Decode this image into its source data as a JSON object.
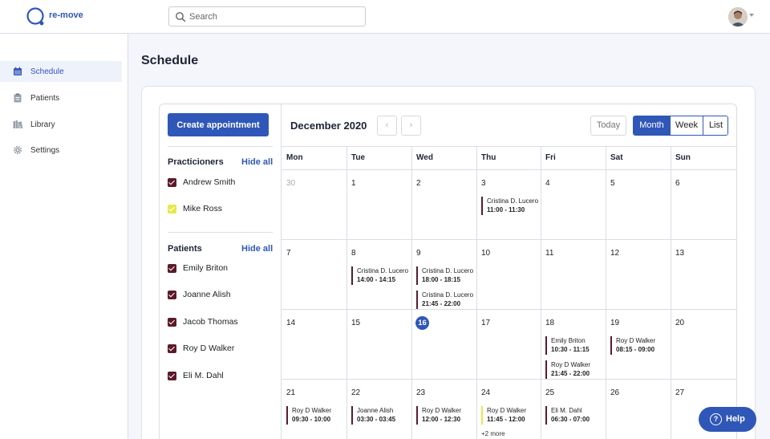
{
  "app": {
    "name": "re-move"
  },
  "search": {
    "placeholder": "Search"
  },
  "sidebar": {
    "items": [
      {
        "label": "Schedule",
        "icon": "calendar-icon",
        "active": true
      },
      {
        "label": "Patients",
        "icon": "clipboard-icon"
      },
      {
        "label": "Library",
        "icon": "library-icon"
      },
      {
        "label": "Settings",
        "icon": "gear-icon"
      }
    ]
  },
  "page": {
    "title": "Schedule"
  },
  "panel": {
    "create_label": "Create appointment",
    "practitioners": {
      "title": "Practicioners",
      "hide_label": "Hide all",
      "items": [
        {
          "name": "Andrew Smith",
          "color": "#5b1b2a"
        },
        {
          "name": "Mike Ross",
          "color": "#e7e84a"
        }
      ]
    },
    "patients": {
      "title": "Patients",
      "hide_label": "Hide all",
      "items": [
        {
          "name": "Emily Briton",
          "color": "#5b1b2a"
        },
        {
          "name": "Joanne Alish",
          "color": "#5b1b2a"
        },
        {
          "name": "Jacob Thomas",
          "color": "#5b1b2a"
        },
        {
          "name": "Roy D Walker",
          "color": "#5b1b2a"
        },
        {
          "name": "Eli M. Dahl",
          "color": "#5b1b2a"
        }
      ]
    }
  },
  "calendar": {
    "month_label": "December 2020",
    "prev_label": "‹",
    "next_label": "›",
    "today_label": "Today",
    "views": [
      "Month",
      "Week",
      "List"
    ],
    "active_view": "Month",
    "weekdays": [
      "Mon",
      "Tue",
      "Wed",
      "Thu",
      "Fri",
      "Sat",
      "Sun"
    ],
    "weeks": [
      [
        "30",
        "1",
        "2",
        "3",
        "4",
        "5",
        "6"
      ],
      [
        "7",
        "8",
        "9",
        "10",
        "11",
        "12",
        "13"
      ],
      [
        "14",
        "15",
        "16",
        "17",
        "18",
        "19",
        "20"
      ],
      [
        "21",
        "22",
        "23",
        "24",
        "25",
        "26",
        "27"
      ]
    ],
    "today": "16",
    "events": [
      {
        "week": 0,
        "day": 3,
        "slot": 0,
        "name": "Cristina D. Lucero",
        "time": "11:00 - 11:30",
        "color": "#5b1b2a"
      },
      {
        "week": 1,
        "day": 1,
        "slot": 0,
        "name": "Cristina D. Lucero",
        "time": "14:00 - 14:15",
        "color": "#5b1b2a"
      },
      {
        "week": 1,
        "day": 2,
        "slot": 0,
        "name": "Cristina D. Lucero",
        "time": "18:00 - 18:15",
        "color": "#5b1b2a"
      },
      {
        "week": 1,
        "day": 2,
        "slot": 1,
        "name": "Cristina D. Lucero",
        "time": "21:45 - 22:00",
        "color": "#5b1b2a"
      },
      {
        "week": 2,
        "day": 4,
        "slot": 0,
        "name": "Emily Briton",
        "time": "10:30 - 11:15",
        "color": "#5b1b2a"
      },
      {
        "week": 2,
        "day": 4,
        "slot": 1,
        "name": "Roy D Walker",
        "time": "21:45 - 22:00",
        "color": "#5b1b2a"
      },
      {
        "week": 2,
        "day": 5,
        "slot": 0,
        "name": "Roy D Walker",
        "time": "08:15 - 09:00",
        "color": "#5b1b2a"
      },
      {
        "week": 3,
        "day": 0,
        "slot": 0,
        "name": "Roy D Walker",
        "time": "09:30 - 10:00",
        "color": "#5b1b2a"
      },
      {
        "week": 3,
        "day": 1,
        "slot": 0,
        "name": "Joanne Alish",
        "time": "03:30 - 03:45",
        "color": "#5b1b2a"
      },
      {
        "week": 3,
        "day": 2,
        "slot": 0,
        "name": "Roy D Walker",
        "time": "12:00 - 12:30",
        "color": "#5b1b2a"
      },
      {
        "week": 3,
        "day": 3,
        "slot": 0,
        "name": "Roy D Walker",
        "time": "11:45 - 12:00",
        "color": "#e7e84a"
      },
      {
        "week": 3,
        "day": 4,
        "slot": 0,
        "name": "Eli M. Dahl",
        "time": "06:30 - 07:00",
        "color": "#5b1b2a"
      }
    ],
    "more": [
      {
        "week": 3,
        "day": 3,
        "label": "+2 more"
      }
    ]
  },
  "help": {
    "label": "Help"
  },
  "colors": {
    "accent": "#2f57b8",
    "event_dark": "#5b1b2a",
    "event_yellow": "#e7e84a"
  }
}
